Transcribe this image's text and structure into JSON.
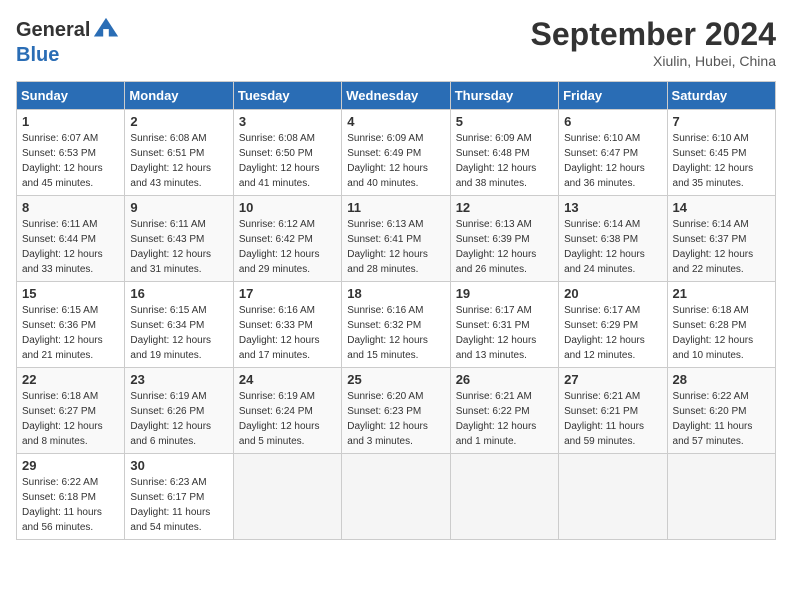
{
  "header": {
    "logo_general": "General",
    "logo_blue": "Blue",
    "month_title": "September 2024",
    "location": "Xiulin, Hubei, China"
  },
  "calendar": {
    "days_of_week": [
      "Sunday",
      "Monday",
      "Tuesday",
      "Wednesday",
      "Thursday",
      "Friday",
      "Saturday"
    ],
    "weeks": [
      [
        {
          "day": "1",
          "sunrise": "6:07 AM",
          "sunset": "6:53 PM",
          "daylight": "12 hours and 45 minutes."
        },
        {
          "day": "2",
          "sunrise": "6:08 AM",
          "sunset": "6:51 PM",
          "daylight": "12 hours and 43 minutes."
        },
        {
          "day": "3",
          "sunrise": "6:08 AM",
          "sunset": "6:50 PM",
          "daylight": "12 hours and 41 minutes."
        },
        {
          "day": "4",
          "sunrise": "6:09 AM",
          "sunset": "6:49 PM",
          "daylight": "12 hours and 40 minutes."
        },
        {
          "day": "5",
          "sunrise": "6:09 AM",
          "sunset": "6:48 PM",
          "daylight": "12 hours and 38 minutes."
        },
        {
          "day": "6",
          "sunrise": "6:10 AM",
          "sunset": "6:47 PM",
          "daylight": "12 hours and 36 minutes."
        },
        {
          "day": "7",
          "sunrise": "6:10 AM",
          "sunset": "6:45 PM",
          "daylight": "12 hours and 35 minutes."
        }
      ],
      [
        {
          "day": "8",
          "sunrise": "6:11 AM",
          "sunset": "6:44 PM",
          "daylight": "12 hours and 33 minutes."
        },
        {
          "day": "9",
          "sunrise": "6:11 AM",
          "sunset": "6:43 PM",
          "daylight": "12 hours and 31 minutes."
        },
        {
          "day": "10",
          "sunrise": "6:12 AM",
          "sunset": "6:42 PM",
          "daylight": "12 hours and 29 minutes."
        },
        {
          "day": "11",
          "sunrise": "6:13 AM",
          "sunset": "6:41 PM",
          "daylight": "12 hours and 28 minutes."
        },
        {
          "day": "12",
          "sunrise": "6:13 AM",
          "sunset": "6:39 PM",
          "daylight": "12 hours and 26 minutes."
        },
        {
          "day": "13",
          "sunrise": "6:14 AM",
          "sunset": "6:38 PM",
          "daylight": "12 hours and 24 minutes."
        },
        {
          "day": "14",
          "sunrise": "6:14 AM",
          "sunset": "6:37 PM",
          "daylight": "12 hours and 22 minutes."
        }
      ],
      [
        {
          "day": "15",
          "sunrise": "6:15 AM",
          "sunset": "6:36 PM",
          "daylight": "12 hours and 21 minutes."
        },
        {
          "day": "16",
          "sunrise": "6:15 AM",
          "sunset": "6:34 PM",
          "daylight": "12 hours and 19 minutes."
        },
        {
          "day": "17",
          "sunrise": "6:16 AM",
          "sunset": "6:33 PM",
          "daylight": "12 hours and 17 minutes."
        },
        {
          "day": "18",
          "sunrise": "6:16 AM",
          "sunset": "6:32 PM",
          "daylight": "12 hours and 15 minutes."
        },
        {
          "day": "19",
          "sunrise": "6:17 AM",
          "sunset": "6:31 PM",
          "daylight": "12 hours and 13 minutes."
        },
        {
          "day": "20",
          "sunrise": "6:17 AM",
          "sunset": "6:29 PM",
          "daylight": "12 hours and 12 minutes."
        },
        {
          "day": "21",
          "sunrise": "6:18 AM",
          "sunset": "6:28 PM",
          "daylight": "12 hours and 10 minutes."
        }
      ],
      [
        {
          "day": "22",
          "sunrise": "6:18 AM",
          "sunset": "6:27 PM",
          "daylight": "12 hours and 8 minutes."
        },
        {
          "day": "23",
          "sunrise": "6:19 AM",
          "sunset": "6:26 PM",
          "daylight": "12 hours and 6 minutes."
        },
        {
          "day": "24",
          "sunrise": "6:19 AM",
          "sunset": "6:24 PM",
          "daylight": "12 hours and 5 minutes."
        },
        {
          "day": "25",
          "sunrise": "6:20 AM",
          "sunset": "6:23 PM",
          "daylight": "12 hours and 3 minutes."
        },
        {
          "day": "26",
          "sunrise": "6:21 AM",
          "sunset": "6:22 PM",
          "daylight": "12 hours and 1 minute."
        },
        {
          "day": "27",
          "sunrise": "6:21 AM",
          "sunset": "6:21 PM",
          "daylight": "11 hours and 59 minutes."
        },
        {
          "day": "28",
          "sunrise": "6:22 AM",
          "sunset": "6:20 PM",
          "daylight": "11 hours and 57 minutes."
        }
      ],
      [
        {
          "day": "29",
          "sunrise": "6:22 AM",
          "sunset": "6:18 PM",
          "daylight": "11 hours and 56 minutes."
        },
        {
          "day": "30",
          "sunrise": "6:23 AM",
          "sunset": "6:17 PM",
          "daylight": "11 hours and 54 minutes."
        },
        null,
        null,
        null,
        null,
        null
      ]
    ]
  }
}
